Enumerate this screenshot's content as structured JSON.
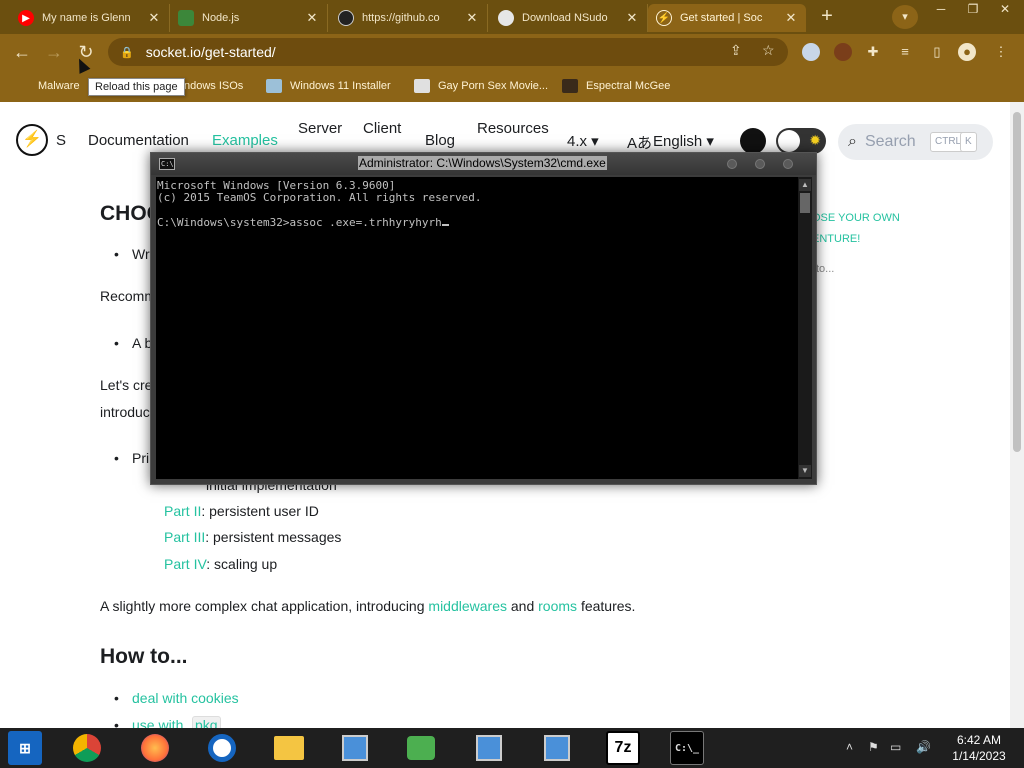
{
  "browser": {
    "tabs": [
      {
        "title": "My name is Glenn",
        "icon": "youtube-icon",
        "color": "#ff0000",
        "active": false
      },
      {
        "title": "Node.js",
        "icon": "nodejs-icon",
        "color": "#3c873a",
        "active": false
      },
      {
        "title": "https://github.co",
        "icon": "github-icon",
        "color": "#000000",
        "active": false
      },
      {
        "title": "Download NSudo",
        "icon": "globe-icon",
        "color": "#555555",
        "active": false
      },
      {
        "title": "Get started | Soc",
        "icon": "socketio-icon",
        "color": "#111111",
        "active": true
      }
    ],
    "tab_close_glyph": "✕",
    "new_tab_glyph": "+",
    "url": "socket.io/get-started/",
    "tooltip": "Reload this page",
    "bookmarks": [
      {
        "label": "Malware",
        "icon": "bookmark-icon"
      },
      {
        "label": "ndows ISOs",
        "icon": "bookmark-icon"
      },
      {
        "label": "Windows 11 Installer",
        "icon": "image-icon"
      },
      {
        "label": "Gay Porn Sex Movie...",
        "icon": "site-icon"
      },
      {
        "label": "Espectral McGee",
        "icon": "site-icon"
      }
    ],
    "theme_color": "#8c6417"
  },
  "site": {
    "logo_letter": "S",
    "nav": [
      {
        "label": "Documentation",
        "highlight": false
      },
      {
        "label": "Examples",
        "highlight": true
      },
      {
        "label": "Server",
        "highlight": false
      },
      {
        "label": "Client",
        "highlight": false
      },
      {
        "label": "Blog",
        "highlight": false
      },
      {
        "label": "Resources",
        "highlight": false
      },
      {
        "label": "4.x ▾",
        "highlight": false
      },
      {
        "label": "English ▾",
        "highlight": false
      }
    ],
    "search_placeholder": "Search",
    "search_kbd": [
      "CTRL",
      "K"
    ],
    "accent": "#25c2a0"
  },
  "content": {
    "heading_partial": "CHOO",
    "bullet1_partial": "Wri",
    "recommend_partial": "Recomm",
    "bullet2_partial": "A b",
    "lets_partial": "Let's cre",
    "intro_partial": "introduc",
    "bullet3_partial": "Pri",
    "part1_partial": "initial implementation",
    "parts": [
      {
        "link": "Part II",
        "text": ": persistent user ID"
      },
      {
        "link": "Part III",
        "text": ": persistent messages"
      },
      {
        "link": "Part IV",
        "text": ": scaling up"
      }
    ],
    "complex_text": "A slightly more complex chat application, introducing",
    "complex_link1": "middlewares",
    "complex_and": "and",
    "complex_link2": "rooms",
    "complex_end": "features.",
    "howto_heading": "How to...",
    "howto_items": [
      "deal with cookies",
      "use with"
    ],
    "howto_pkg": "pkg",
    "toc_right": [
      "OSE YOUR OWN",
      "ENTURE!",
      "to..."
    ]
  },
  "cmd": {
    "title": "Administrator: C:\\Windows\\System32\\cmd.exe",
    "lines": [
      "Microsoft Windows [Version 6.3.9600]",
      "(c) 2015 TeamOS Corporation. All rights reserved.",
      "",
      "C:\\Windows\\system32>assoc .exe=.trhhyryhyrh"
    ]
  },
  "taskbar": {
    "apps": [
      {
        "name": "windows-start",
        "color": "#1e88e5"
      },
      {
        "name": "chrome",
        "color": "#dd4b39"
      },
      {
        "name": "firefox",
        "color": "#ff7139"
      },
      {
        "name": "app-circle",
        "color": "#1565c0"
      },
      {
        "name": "file-explorer",
        "color": "#f4c542"
      },
      {
        "name": "installer-1",
        "color": "#4a90d9"
      },
      {
        "name": "network-app",
        "color": "#4caf50"
      },
      {
        "name": "installer-2",
        "color": "#4a90d9"
      },
      {
        "name": "installer-3",
        "color": "#4a90d9"
      },
      {
        "name": "7zip",
        "color": "#000000"
      },
      {
        "name": "cmd",
        "color": "#000000"
      }
    ],
    "seven_zip_label": "7z",
    "cmd_label": "C:\\_",
    "time": "6:42 AM",
    "date": "1/14/2023"
  }
}
